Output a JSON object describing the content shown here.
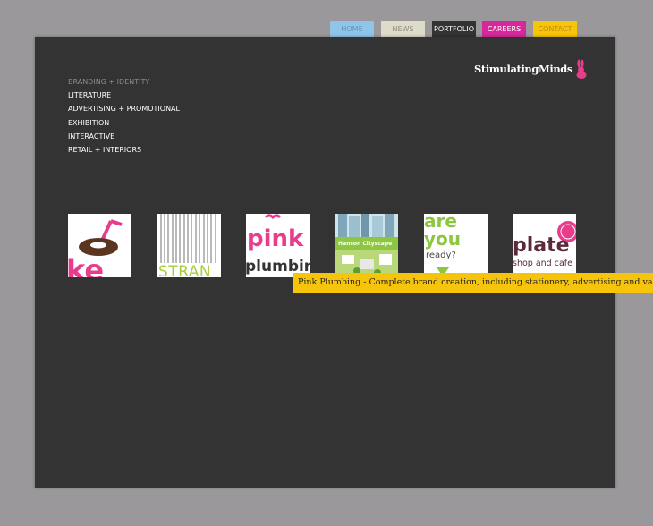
{
  "tabs": [
    {
      "label": "HOME",
      "bg": "#8fc5e8",
      "color": "#6a8fb3"
    },
    {
      "label": "NEWS",
      "bg": "#dedcc8",
      "color": "#8b8a7c"
    },
    {
      "label": "PORTFOLIO",
      "bg": "#333333",
      "color": "#ffffff"
    },
    {
      "label": "CAREERS",
      "bg": "#d6289a",
      "color": "#ffffff"
    },
    {
      "label": "CONTACT",
      "bg": "#f6c40a",
      "color": "#c08a10"
    }
  ],
  "logo": {
    "text": "StimulatingMinds",
    "icon": "rabbit-icon",
    "accent": "#e83c8c"
  },
  "nav": [
    {
      "label": "BRANDING + IDENTITY",
      "active": true
    },
    {
      "label": "LITERATURE",
      "active": false
    },
    {
      "label": "ADVERTISING + PROMOTIONAL",
      "active": false
    },
    {
      "label": "EXHIBITION",
      "active": false
    },
    {
      "label": "INTERACTIVE",
      "active": false
    },
    {
      "label": "RETAIL + INTERIORS",
      "active": false
    }
  ],
  "thumbnails": [
    {
      "name": "cafe-brand-thumb",
      "text": "ke"
    },
    {
      "name": "strand-thumb",
      "text": "STRAN"
    },
    {
      "name": "pink-plumbing-thumb",
      "text_top": "pink",
      "text_bottom": "plumbin"
    },
    {
      "name": "hanson-cityscape-thumb",
      "text": "Hanson Cityscape"
    },
    {
      "name": "are-you-ready-thumb",
      "text_lines": [
        "are",
        "you",
        "ready?"
      ]
    },
    {
      "name": "plate-thumb",
      "text_top": "plate",
      "text_bottom": "shop and cafe"
    }
  ],
  "tooltip": {
    "text": "Pink Plumbing - Complete brand creation, including stationery, advertising and va"
  },
  "colors": {
    "background": "#9a989a",
    "panel": "#333333",
    "tooltip": "#f6c40a",
    "pink": "#e83c8c",
    "green": "#8dc63f"
  }
}
